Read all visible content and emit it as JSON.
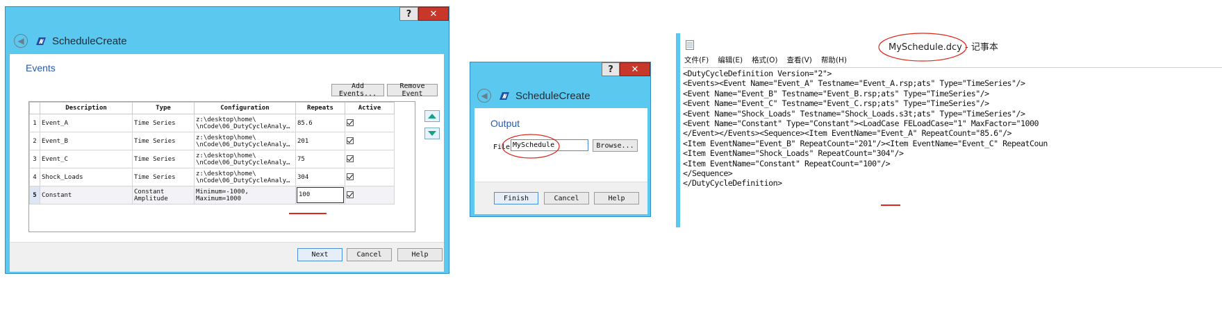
{
  "dialog1": {
    "title": "ScheduleCreate",
    "help_glyph": "?",
    "close_glyph": "✕",
    "section": "Events",
    "add_events": "Add Events...",
    "remove_event": "Remove Event",
    "columns": [
      "Description",
      "Type",
      "Configuration",
      "Repeats",
      "Active"
    ],
    "rows": [
      {
        "num": "1",
        "description": "Event_A",
        "type": "Time Series",
        "config": [
          "z:\\desktop\\home\\",
          "\\nCode\\06_DutyCycleAnaly…"
        ],
        "repeats": "85.6",
        "active": true
      },
      {
        "num": "2",
        "description": "Event_B",
        "type": "Time Series",
        "config": [
          "z:\\desktop\\home\\",
          "\\nCode\\06_DutyCycleAnaly…"
        ],
        "repeats": "201",
        "active": true
      },
      {
        "num": "3",
        "description": "Event_C",
        "type": "Time Series",
        "config": [
          "z:\\desktop\\home\\",
          "\\nCode\\06_DutyCycleAnaly…"
        ],
        "repeats": "75",
        "active": true
      },
      {
        "num": "4",
        "description": "Shock_Loads",
        "type": "Time Series",
        "config": [
          "z:\\desktop\\home\\",
          "\\nCode\\06_DutyCycleAnaly…"
        ],
        "repeats": "304",
        "active": true
      },
      {
        "num": "5",
        "description": "Constant",
        "type": "Constant Amplitude",
        "config": [
          "Minimum=-1000,",
          "Maximum=1000"
        ],
        "repeats": "100",
        "active": true
      }
    ],
    "next": "Next",
    "cancel": "Cancel",
    "help": "Help"
  },
  "dialog2": {
    "title": "ScheduleCreate",
    "help_glyph": "?",
    "close_glyph": "✕",
    "section": "Output",
    "file_label": "File",
    "file_value": "MySchedule",
    "browse": "Browse...",
    "finish": "Finish",
    "cancel": "Cancel",
    "help": "Help"
  },
  "notepad": {
    "title": "MySchedule.dcy - 记事本",
    "menu": [
      "文件(F)",
      "编辑(E)",
      "格式(O)",
      "查看(V)",
      "帮助(H)"
    ],
    "lines": [
      "<DutyCycleDefinition Version=\"2\">",
      "<Events><Event Name=\"Event_A\" Testname=\"Event_A.rsp;ats\" Type=\"TimeSeries\"/>",
      "<Event Name=\"Event_B\" Testname=\"Event_B.rsp;ats\" Type=\"TimeSeries\"/>",
      "<Event Name=\"Event_C\" Testname=\"Event_C.rsp;ats\" Type=\"TimeSeries\"/>",
      "<Event Name=\"Shock_Loads\" Testname=\"Shock_Loads.s3t;ats\" Type=\"TimeSeries\"/>",
      "<Event Name=\"Constant\" Type=\"Constant\"><LoadCase FELoadCase=\"1\" MaxFactor=\"1000",
      "</Event></Events><Sequence><Item EventName=\"Event_A\" RepeatCount=\"85.6\"/>",
      "<Item EventName=\"Event_B\" RepeatCount=\"201\"/><Item EventName=\"Event_C\" RepeatCoun",
      "<Item EventName=\"Shock_Loads\" RepeatCount=\"304\"/>",
      "<Item EventName=\"Constant\" RepeatCount=\"100\"/>",
      "</Sequence>",
      "</DutyCycleDefinition>"
    ]
  },
  "colors": {
    "frame": "#5bc8f0",
    "accent_red": "#e0251b",
    "section_blue": "#2a5aa8",
    "arrow_teal": "#1aa08a"
  }
}
